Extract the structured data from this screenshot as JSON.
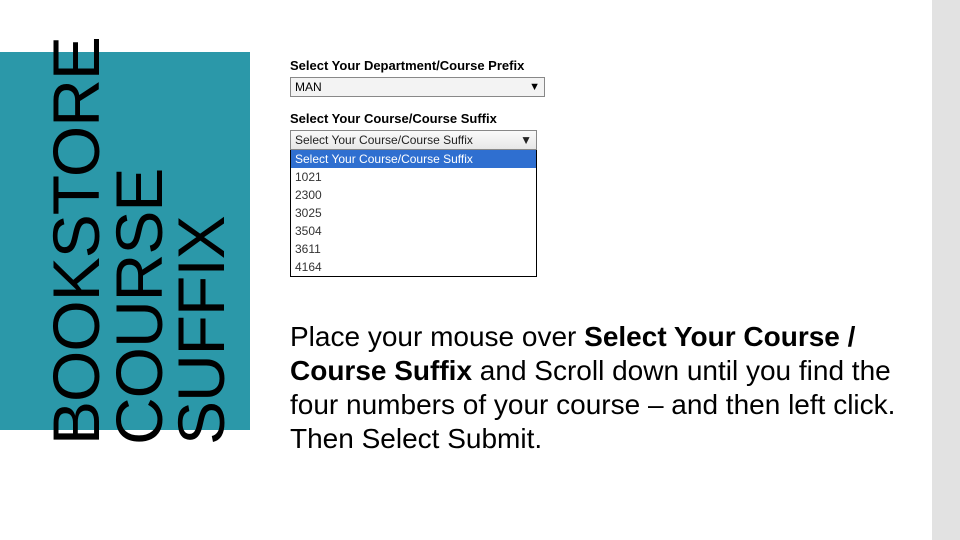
{
  "sidebar": {
    "line1": "BOOKSTORE",
    "line2": "COURSE",
    "line3": "SUFFIX"
  },
  "form": {
    "dept_label": "Select Your Department/Course Prefix",
    "dept_value": "MAN",
    "suffix_label": "Select Your Course/Course Suffix",
    "suffix_value": "Select Your Course/Course Suffix",
    "options": {
      "o0": "Select Your Course/Course Suffix",
      "o1": "1021",
      "o2": "2300",
      "o3": "3025",
      "o4": "3504",
      "o5": "3611",
      "o6": "4164"
    }
  },
  "instruction": {
    "t1": "Place your mouse over ",
    "b1": "Select Your Course / Course Suffix",
    "t2": " and Scroll down until you find the four numbers of your course – and then left click. Then Select Submit."
  }
}
